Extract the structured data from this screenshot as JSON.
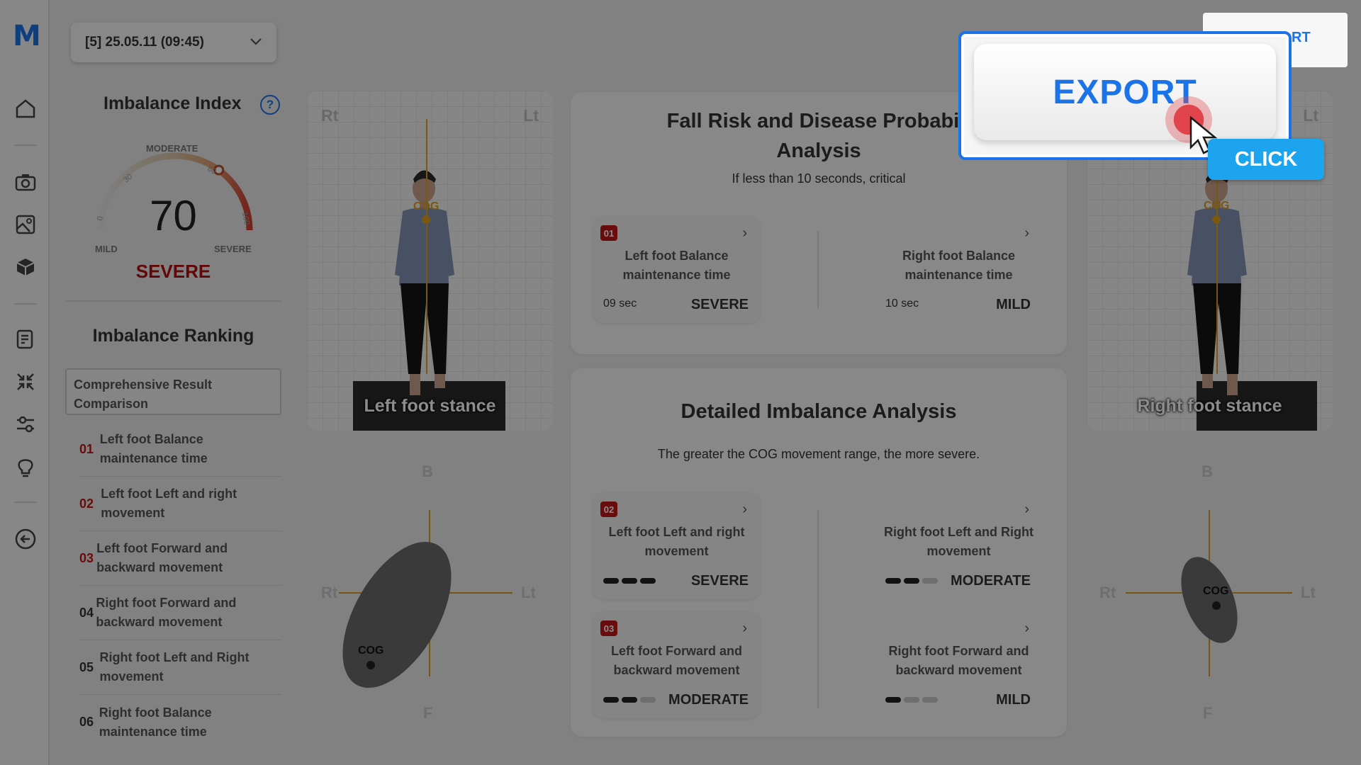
{
  "app": {
    "logo": "M"
  },
  "session": {
    "label": "[5] 25.05.11 (09:45)"
  },
  "imbalance_index": {
    "title": "Imbalance Index",
    "help": "?",
    "value": "70",
    "level": 0.7,
    "severity": "SEVERE",
    "labels": {
      "moderate": "MODERATE",
      "mild": "MILD",
      "severe": "SEVERE"
    },
    "ticks": [
      "0",
      "30",
      "60",
      "100"
    ]
  },
  "ranking": {
    "title": "Imbalance Ranking",
    "comprehensive": "Comprehensive Result Comparison",
    "items": [
      {
        "num": "01",
        "label": "Left foot Balance maintenance time",
        "highlight": true
      },
      {
        "num": "02",
        "label": "Left foot Left and right movement",
        "highlight": true
      },
      {
        "num": "03",
        "label": "Left foot Forward and backward movement",
        "highlight": true
      },
      {
        "num": "04",
        "label": "Right foot Forward and backward movement",
        "highlight": false
      },
      {
        "num": "05",
        "label": "Right foot Left and Right movement",
        "highlight": false
      },
      {
        "num": "06",
        "label": "Right foot Balance maintenance time",
        "highlight": false
      }
    ]
  },
  "left_photo": {
    "rt": "Rt",
    "lt": "Lt",
    "cog": "COG",
    "caption": "Left foot stance"
  },
  "right_photo": {
    "lt": "Lt",
    "cog": "COG",
    "caption": "Right foot stance"
  },
  "fall_risk": {
    "title_line1": "Fall Risk and Disease Probabili",
    "title_line2": "Analysis",
    "subtitle": "If less than 10 seconds, critical",
    "left": {
      "badge": "01",
      "label": "Left foot Balance maintenance time",
      "value": "09 sec",
      "severity": "SEVERE"
    },
    "right": {
      "label": "Right foot Balance maintenance time",
      "value": "10 sec",
      "severity": "MILD"
    }
  },
  "detailed": {
    "title": "Detailed Imbalance Analysis",
    "subtitle": "The greater the COG movement range, the more severe.",
    "cards": [
      {
        "badge": "02",
        "label": "Left foot Left and right movement",
        "severity": "SEVERE",
        "level": 3
      },
      {
        "badge": "",
        "label": "Right foot Left and Right movement",
        "severity": "MODERATE",
        "level": 2
      },
      {
        "badge": "03",
        "label": "Left foot Forward and backward movement",
        "severity": "MODERATE",
        "level": 2
      },
      {
        "badge": "",
        "label": "Right foot Forward and backward movement",
        "severity": "MILD",
        "level": 1
      }
    ]
  },
  "left_plot": {
    "b": "B",
    "f": "F",
    "rt": "Rt",
    "lt": "Lt",
    "cog": "COG"
  },
  "right_plot": {
    "b": "B",
    "f": "F",
    "rt": "Rt",
    "lt": "Lt",
    "cog": "COG"
  },
  "overlay": {
    "export_label": "EXPORT",
    "export_partial": "RT",
    "click_label": "CLICK"
  },
  "icons": [
    "home-icon",
    "camera-icon",
    "gallery-icon",
    "cube-icon",
    "report-icon",
    "compress-icon",
    "sliders-icon",
    "bulb-icon",
    "back-icon"
  ],
  "colors": {
    "accent": "#1a73e8",
    "severe": "#c0171b",
    "click": "#1ca4ef"
  }
}
